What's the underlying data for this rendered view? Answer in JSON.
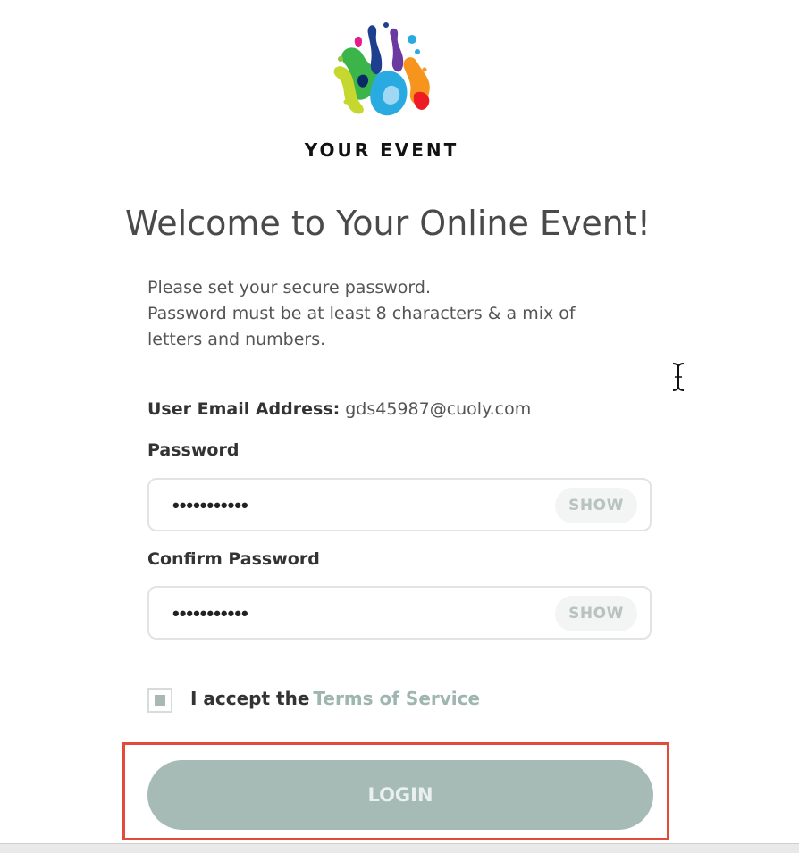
{
  "brand": {
    "logo_icon": "colorful-splash-logo",
    "name": "YOUR EVENT"
  },
  "page": {
    "title": "Welcome to Your Online Event!",
    "intro_lines": [
      "Please set your secure password.",
      "Password must be at least 8 characters & a mix of",
      "letters and numbers."
    ]
  },
  "form": {
    "email_label": "User Email Address:",
    "email_value": "gds45987@cuoly.com",
    "password": {
      "label": "Password",
      "value_masked": "•••••••••••",
      "show_label": "SHOW"
    },
    "confirm_password": {
      "label": "Confirm Password",
      "value_masked": "•••••••••••",
      "show_label": "SHOW"
    },
    "terms": {
      "checked": true,
      "prefix": "I accept the",
      "link_text": "Terms of Service"
    },
    "login_label": "LOGIN"
  },
  "colors": {
    "accent": "#a7bbb6",
    "link": "#9fb5b0",
    "highlight": "#e24b3b"
  }
}
